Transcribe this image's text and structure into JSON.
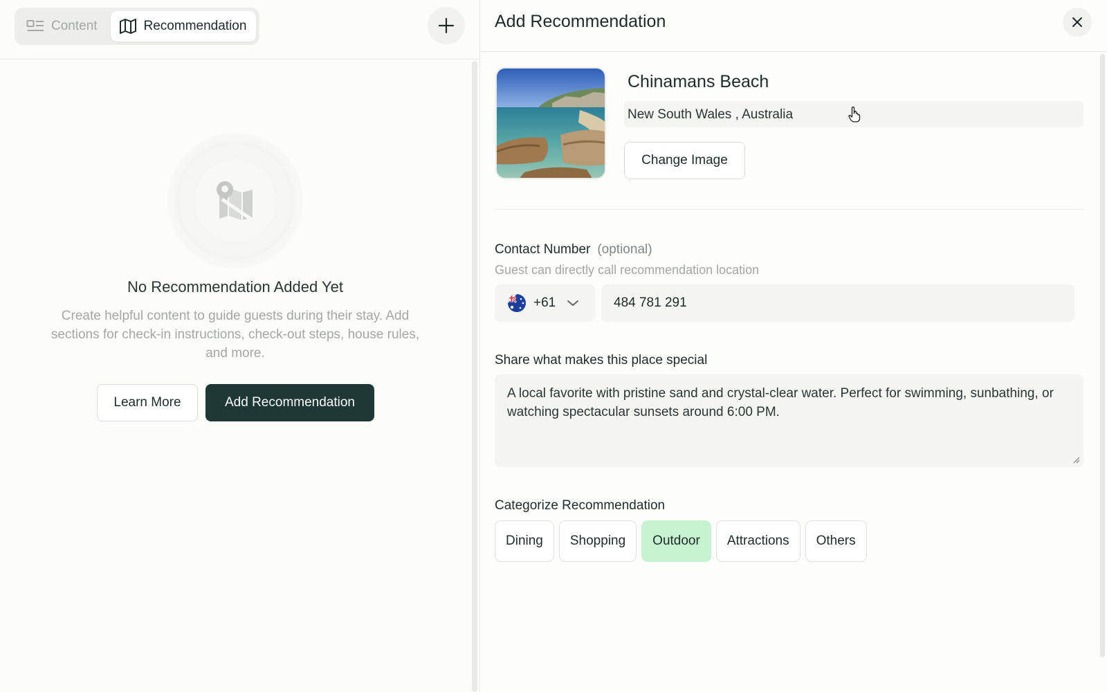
{
  "tabs": {
    "content_label": "Content",
    "recommendation_label": "Recommendation"
  },
  "empty_state": {
    "title": "No Recommendation Added Yet",
    "description": "Create helpful content to guide guests during their stay. Add sections for check-in instructions, check-out steps, house rules, and more.",
    "learn_more_label": "Learn More",
    "add_label": "Add Recommendation"
  },
  "panel": {
    "title": "Add Recommendation",
    "place_name": "Chinamans Beach",
    "place_location": "New South Wales , Australia",
    "change_image_label": "Change Image",
    "contact": {
      "label": "Contact Number",
      "optional": "(optional)",
      "helper": "Guest can directly call recommendation location",
      "country_code": "+61",
      "phone": "484 781 291"
    },
    "special": {
      "label": "Share what makes this place special",
      "text": "A local favorite with pristine sand and crystal-clear water. Perfect for swimming, sunbathing, or watching spectacular sunsets around 6:00 PM."
    },
    "category": {
      "label": "Categorize Recommendation",
      "options": [
        "Dining",
        "Shopping",
        "Outdoor",
        "Attractions",
        "Others"
      ],
      "selected": "Outdoor"
    }
  },
  "colors": {
    "primary_dark": "#1e3835",
    "selected_chip": "#c6f2cf",
    "muted_text": "#a3a8a4"
  },
  "icons": {
    "content_tab": "layout-icon",
    "recommendation_tab": "map-icon",
    "add": "plus-icon",
    "empty_state": "map-pin-off-icon",
    "close": "close-icon",
    "country_flag": "australia-flag-icon",
    "dropdown": "chevron-down-icon"
  }
}
